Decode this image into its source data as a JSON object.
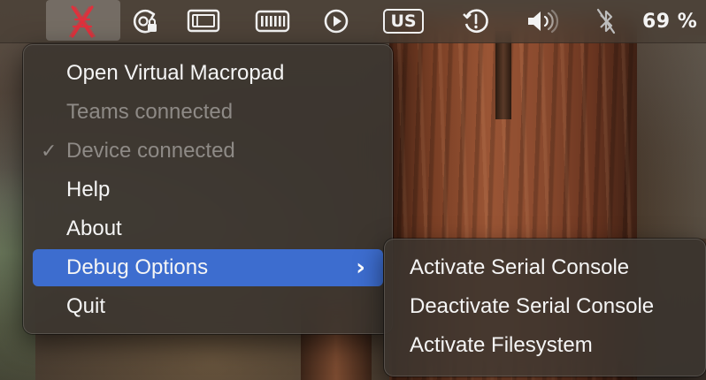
{
  "menubar": {
    "items": [
      {
        "name": "macropad-status-icon",
        "active": true
      },
      {
        "name": "screen-lock-icon"
      },
      {
        "name": "display-icon"
      },
      {
        "name": "keyboard-icon"
      },
      {
        "name": "play-icon"
      },
      {
        "name": "input-source",
        "label": "US"
      },
      {
        "name": "time-machine-icon"
      },
      {
        "name": "volume-icon"
      },
      {
        "name": "bluetooth-off-icon"
      },
      {
        "name": "battery",
        "label": "69 %"
      }
    ],
    "input_source_label": "US",
    "battery_label": "69 %"
  },
  "main_menu": {
    "items": [
      {
        "label": "Open Virtual Macropad",
        "enabled": true
      },
      {
        "label": "Teams connected",
        "enabled": false
      },
      {
        "label": "Device connected",
        "enabled": false,
        "checked": true,
        "check_mark": "✓"
      },
      {
        "label": "Help",
        "enabled": true
      },
      {
        "label": "About",
        "enabled": true
      },
      {
        "label": "Debug Options",
        "enabled": true,
        "highlighted": true,
        "submenu": true,
        "chevron": "›"
      },
      {
        "label": "Quit",
        "enabled": true
      }
    ]
  },
  "submenu": {
    "parent": "Debug Options",
    "items": [
      {
        "label": "Activate Serial Console"
      },
      {
        "label": "Deactivate Serial Console"
      },
      {
        "label": "Activate Filesystem"
      }
    ]
  },
  "colors": {
    "highlight": "#3d6dcf",
    "macropad_icon": "#e0303c",
    "text": "#f5f5f5",
    "disabled_text": "#8e8a86"
  }
}
